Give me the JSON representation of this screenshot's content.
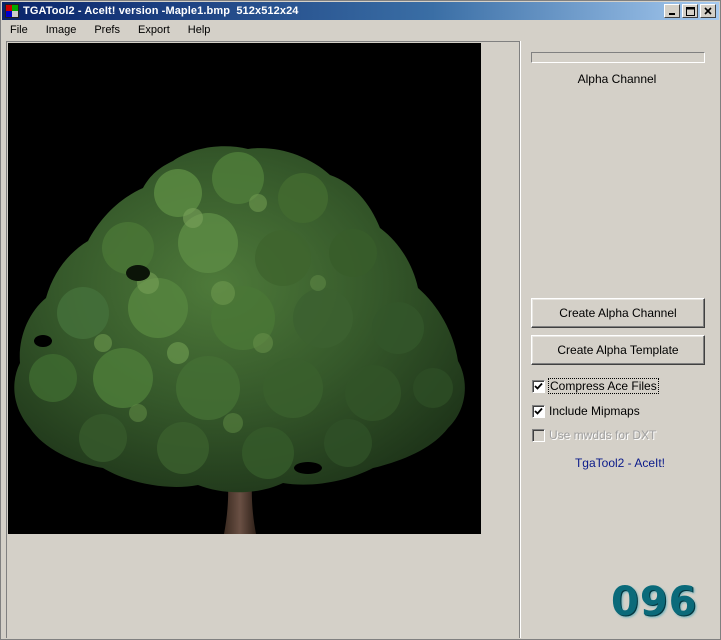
{
  "window": {
    "title": "TGATool2 - AceIt! version -Maple1.bmp  512x512x24",
    "controls": [
      "minimize",
      "maximize",
      "close"
    ]
  },
  "menu": {
    "items": [
      {
        "label": "File"
      },
      {
        "label": "Image"
      },
      {
        "label": "Prefs"
      },
      {
        "label": "Export"
      },
      {
        "label": "Help"
      }
    ]
  },
  "image": {
    "subject": "maple-tree-icon",
    "background_color": "#000000"
  },
  "panel": {
    "progress_fraction": 0,
    "alpha_label": "Alpha Channel",
    "create_alpha_channel_label": "Create Alpha Channel",
    "create_alpha_template_label": "Create Alpha Template",
    "options": [
      {
        "label": "Compress Ace Files",
        "checked": true,
        "enabled": true
      },
      {
        "label": "Include Mipmaps",
        "checked": true,
        "enabled": true
      },
      {
        "label": "Use mwdds for DXT",
        "checked": false,
        "enabled": false
      }
    ],
    "brand": "TgaTool2 - AceIt!",
    "counter": "096"
  },
  "colors": {
    "title_gradient_start": "#0a246a",
    "title_gradient_end": "#a6caf0",
    "face": "#d4d0c8",
    "brand_text": "#0a1a8a",
    "counter_text": "#0a6a7a"
  }
}
